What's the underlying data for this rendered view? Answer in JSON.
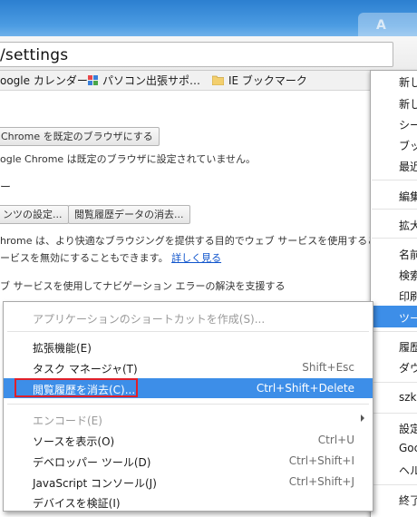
{
  "titlebar": {
    "ghost_text": "A"
  },
  "address_bar": {
    "url_text": "/settings"
  },
  "bookmarks": [
    {
      "label": "oogle カレンダー",
      "icon": "none"
    },
    {
      "label": "パソコン出張サポ…",
      "icon": "puzzle-icon"
    },
    {
      "label": "IE ブックマーク",
      "icon": "folder-icon"
    }
  ],
  "page": {
    "default_browser_button": "Chrome を既定のブラウザにする",
    "default_browser_status": "ogle Chrome は既定のブラウザに設定されていません。",
    "privacy_heading": "ー",
    "content_settings_button": "ンツの設定...",
    "clear_data_button": "閲覧履歴データの消去...",
    "privacy_desc_1": "hrome は、より快適なブラウジングを提供する目的でウェブ サービスを使用するこ",
    "privacy_desc_2": "ービスを無効にすることもできます。",
    "learn_more_link": "詳しく見る",
    "nav_error_option": "ブ サービスを使用してナビゲーション エラーの解決を支援する",
    "bottom_fragment": "シー"
  },
  "submenu": {
    "items": [
      {
        "label": "アプリケーションのショートカットを作成(S)...",
        "shortcut": "",
        "disabled": true
      },
      {
        "label": "拡張機能(E)",
        "shortcut": ""
      },
      {
        "label": "タスク マネージャ(T)",
        "shortcut": "Shift+Esc"
      },
      {
        "label": "閲覧履歴を消去(C)...",
        "shortcut": "Ctrl+Shift+Delete",
        "highlighted": true
      },
      {
        "label": "エンコード(E)",
        "shortcut": "",
        "disabled": true
      },
      {
        "label": "ソースを表示(O)",
        "shortcut": "Ctrl+U"
      },
      {
        "label": "デベロッパー ツール(D)",
        "shortcut": "Ctrl+Shift+I"
      },
      {
        "label": "JavaScript コンソール(J)",
        "shortcut": "Ctrl+Shift+J"
      },
      {
        "label": "デバイスを検証(I)",
        "shortcut": ""
      }
    ],
    "highlight_color": "#3d8ee8",
    "callout_color": "#e0202a"
  },
  "main_menu": {
    "items": [
      "新し",
      "新し",
      "シー",
      "ブッ",
      "最近",
      "編集",
      "拡大",
      "名前",
      "検索",
      "印刷",
      "ツー",
      "履歴",
      "ダウ",
      "szku",
      "設定",
      "Goc",
      "ヘル",
      "終了"
    ],
    "highlighted_item": "ツー"
  }
}
